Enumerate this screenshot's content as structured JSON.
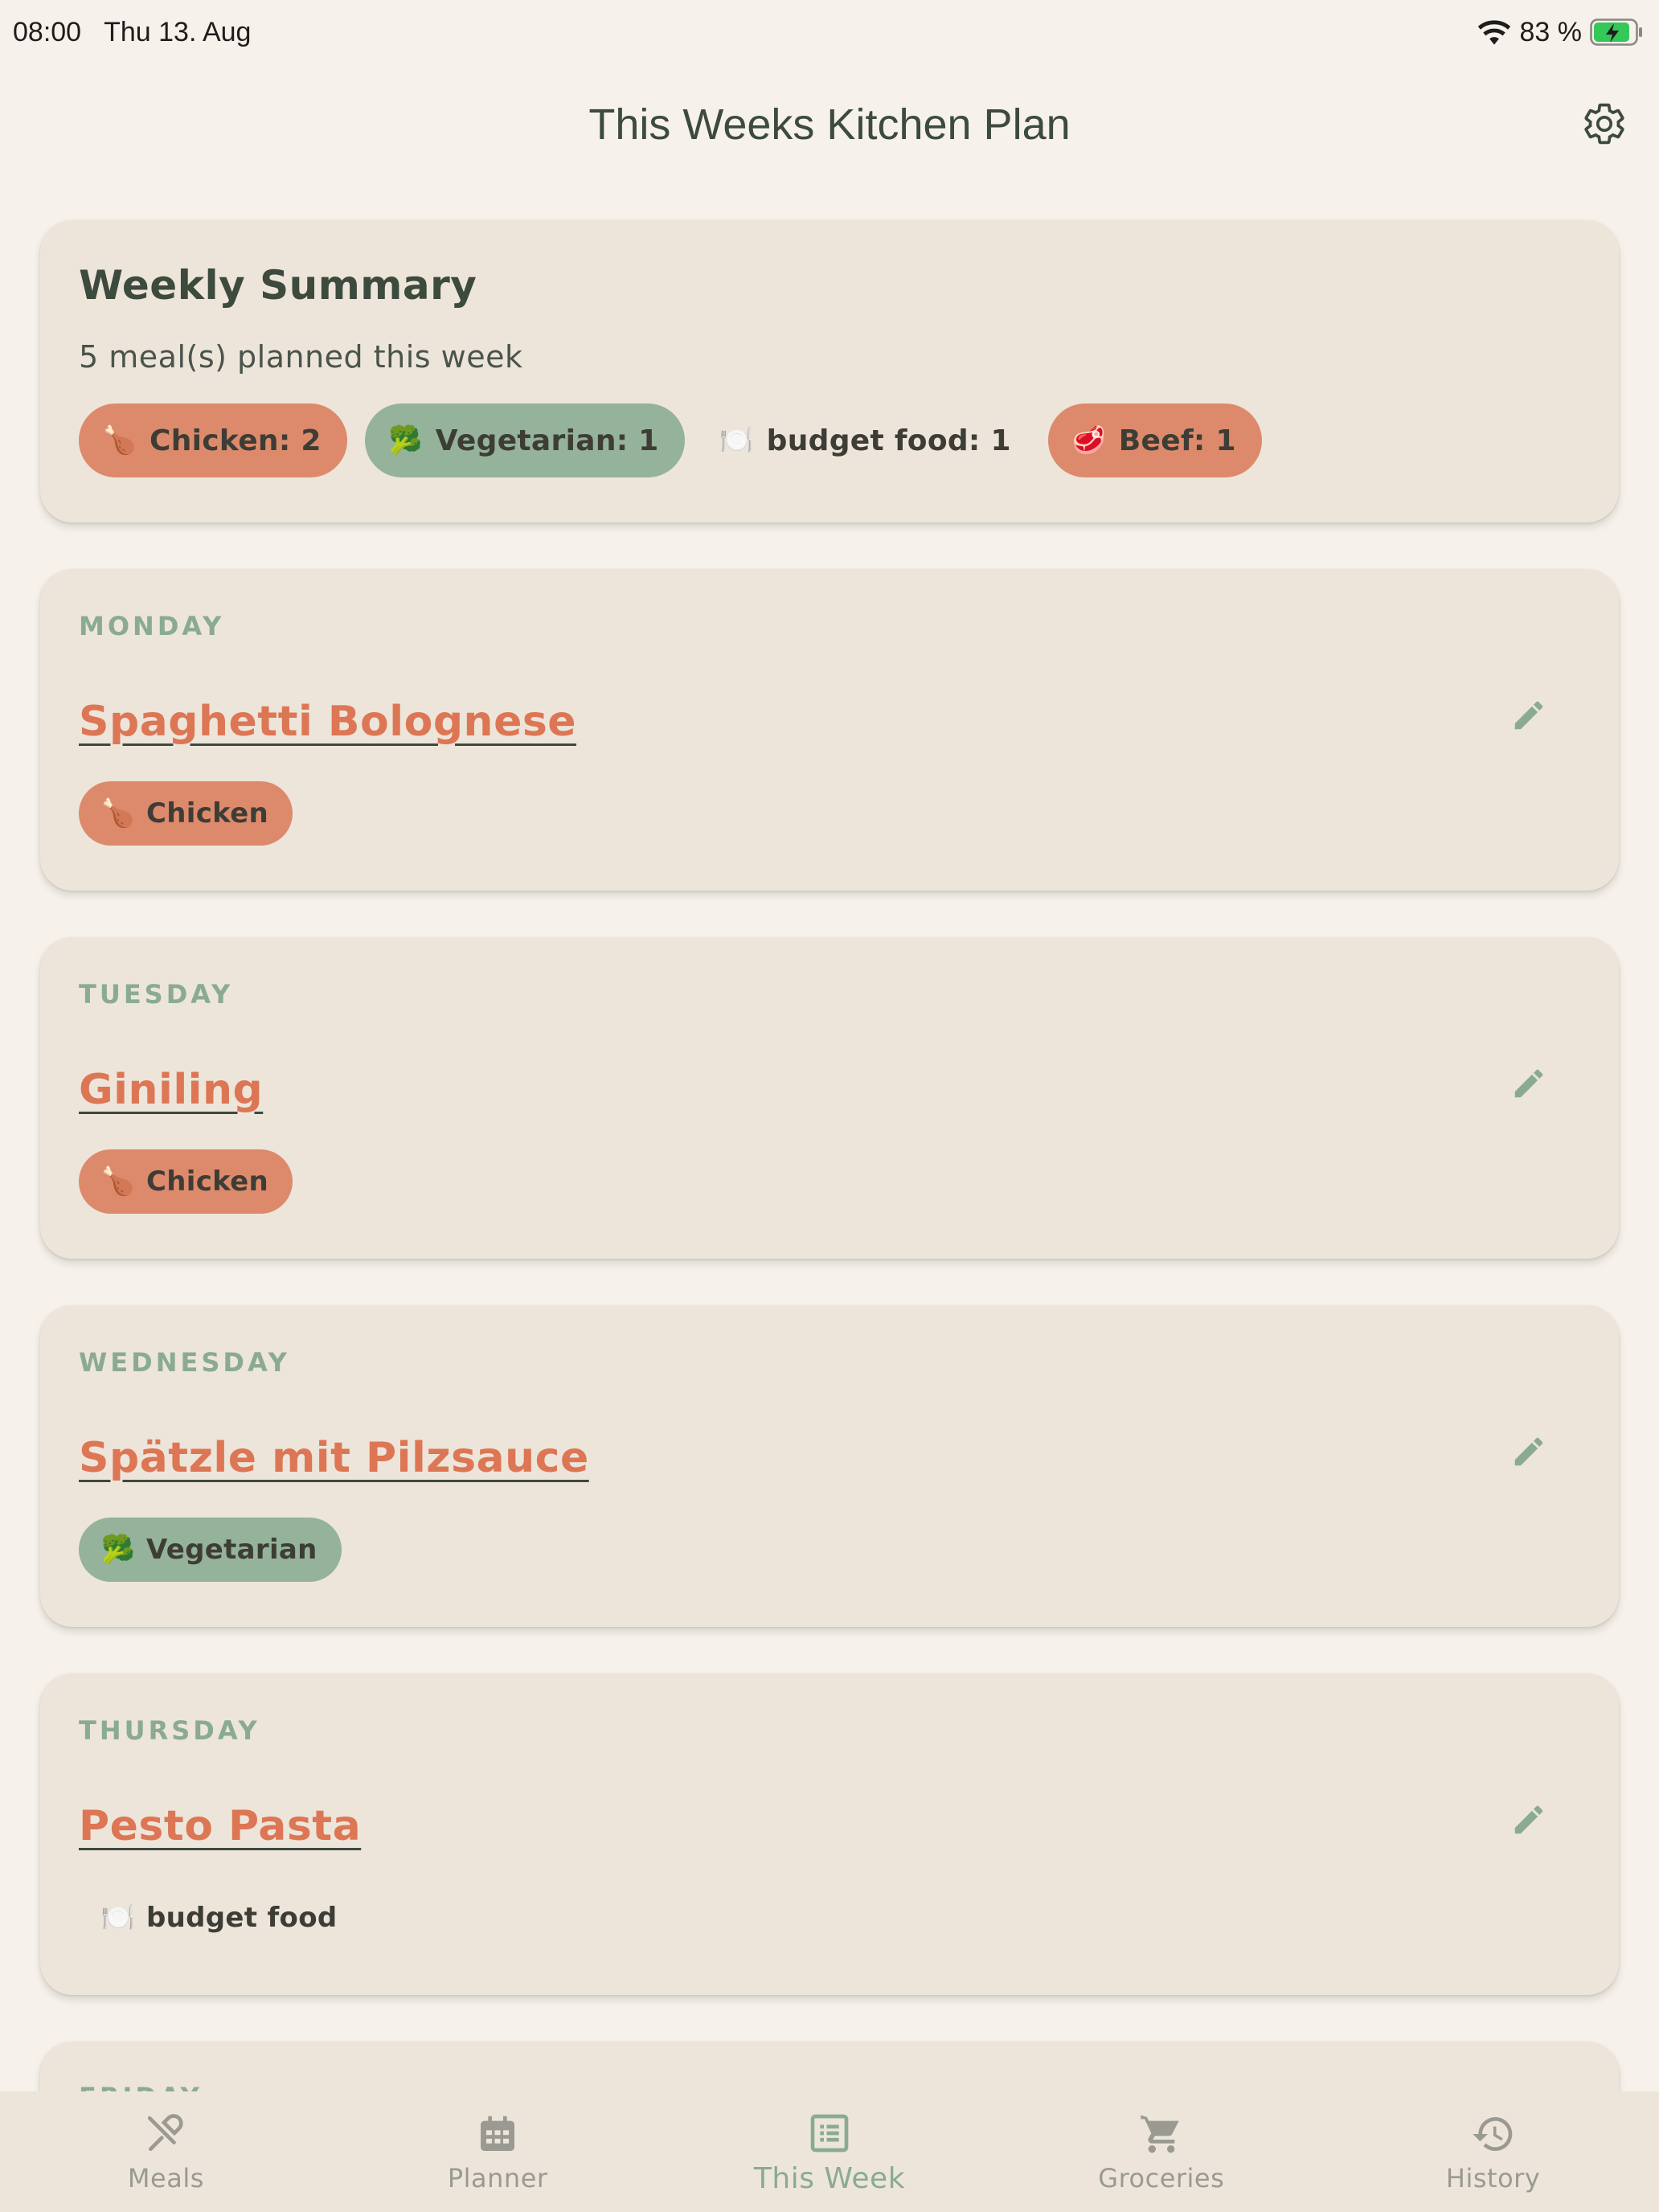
{
  "status_bar": {
    "time": "08:00",
    "date": "Thu 13. Aug",
    "battery": "83 %",
    "icons": [
      "wifi-icon",
      "battery-charging-icon"
    ]
  },
  "header": {
    "title": "This Weeks Kitchen Plan",
    "settings_icon": "gear-icon"
  },
  "summary": {
    "title": "Weekly Summary",
    "subtitle": "5 meal(s) planned this week",
    "chips": [
      {
        "icon": "🍗",
        "label": "Chicken: 2",
        "color": "#dd8a6c"
      },
      {
        "icon": "🥦",
        "label": "Vegetarian: 1",
        "color": "#95b29b"
      },
      {
        "icon": "🍽️",
        "label": "budget food: 1",
        "color": "transparent"
      },
      {
        "icon": "🥩",
        "label": "Beef: 1",
        "color": "#dd8a6c"
      }
    ]
  },
  "days": [
    {
      "day": "MONDAY",
      "meal": "Spaghetti Bolognese",
      "tag": {
        "icon": "🍗",
        "label": "Chicken",
        "color": "#dd8a6c"
      }
    },
    {
      "day": "TUESDAY",
      "meal": "Giniling",
      "tag": {
        "icon": "🍗",
        "label": "Chicken",
        "color": "#dd8a6c"
      }
    },
    {
      "day": "WEDNESDAY",
      "meal": "Spätzle mit Pilzsauce",
      "tag": {
        "icon": "🥦",
        "label": "Vegetarian",
        "color": "#95b29b"
      }
    },
    {
      "day": "THURSDAY",
      "meal": "Pesto Pasta",
      "tag": {
        "icon": "🍽️",
        "label": "budget food",
        "color": "transparent"
      }
    }
  ],
  "partial_day": "FRIDAY",
  "nav": {
    "items": [
      {
        "label": "Meals",
        "icon": "fork-knife-icon"
      },
      {
        "label": "Planner",
        "icon": "calendar-icon"
      },
      {
        "label": "This Week",
        "icon": "list-icon"
      },
      {
        "label": "Groceries",
        "icon": "cart-icon"
      },
      {
        "label": "History",
        "icon": "history-icon"
      }
    ],
    "active": "This Week"
  },
  "colors": {
    "background": "#f6f2eb",
    "card": "#ede5da",
    "accent_green": "#8aab90",
    "accent_orange": "#dd7654",
    "text_dark": "#3d4a3e"
  }
}
